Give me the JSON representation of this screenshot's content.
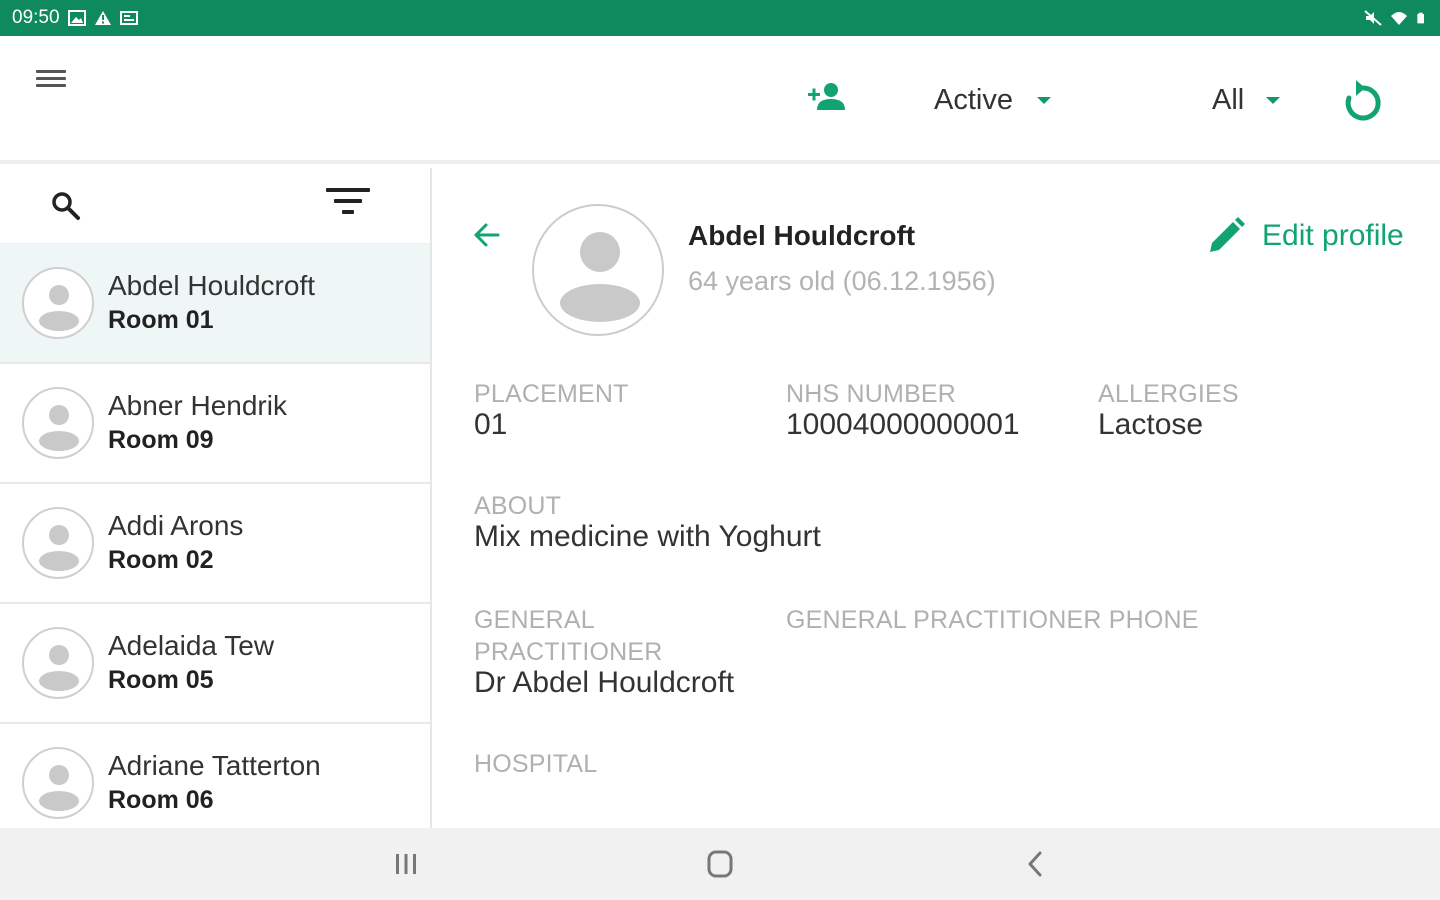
{
  "statusbar": {
    "time": "09:50"
  },
  "appbar": {
    "status_filter": "Active",
    "group_filter": "All"
  },
  "patients": [
    {
      "name": "Abdel Houldcroft",
      "room": "Room 01"
    },
    {
      "name": "Abner Hendrik",
      "room": "Room 09"
    },
    {
      "name": "Addi Arons",
      "room": "Room 02"
    },
    {
      "name": "Adelaida Tew",
      "room": "Room 05"
    },
    {
      "name": "Adriane Tatterton",
      "room": "Room 06"
    }
  ],
  "profile": {
    "name": "Abdel Houldcroft",
    "age": "64 years old (06.12.1956)",
    "edit_label": "Edit profile",
    "placement_label": "PLACEMENT",
    "placement_value": "01",
    "nhs_label": "NHS NUMBER",
    "nhs_value": "10004000000001",
    "allergies_label": "ALLERGIES",
    "allergies_value": "Lactose",
    "about_label": "ABOUT",
    "about_value": "Mix medicine with Yoghurt",
    "gp_label_line1": "GENERAL",
    "gp_label_line2": "PRACTITIONER",
    "gp_value": "Dr Abdel Houldcroft",
    "gp_phone_label": "GENERAL PRACTITIONER PHONE",
    "hospital_label": "HOSPITAL"
  },
  "colors": {
    "status_bar": "#0f8a5f",
    "accent": "#11a472",
    "selected_row": "#eef7f6"
  },
  "icons": [
    "menu-icon",
    "add-user-icon",
    "refresh-icon",
    "search-icon",
    "sort-icon",
    "back-arrow-icon",
    "edit-pencil-icon",
    "avatar-placeholder-icon"
  ]
}
